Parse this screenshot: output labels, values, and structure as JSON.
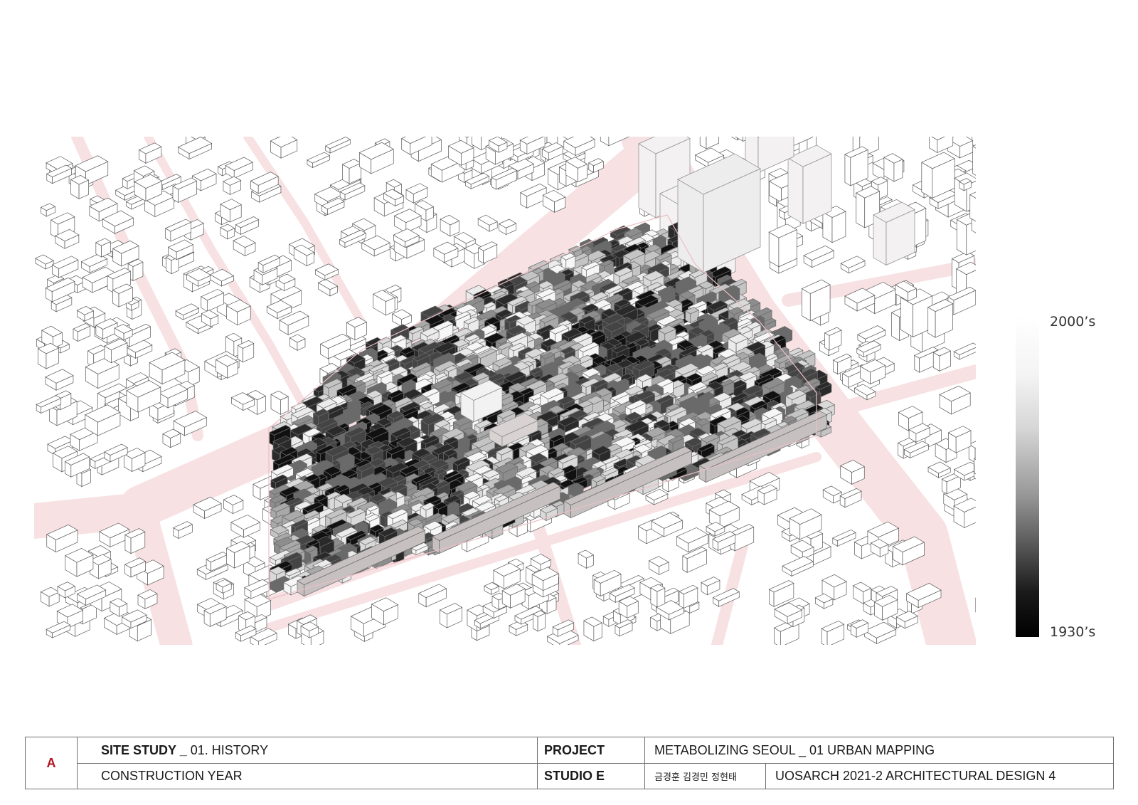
{
  "legend": {
    "top_label": "2000’s",
    "bottom_label": "1930’s",
    "gradient": "white-to-black"
  },
  "colors": {
    "road": "#f7e1e3",
    "road_edge": "#e9bfc4",
    "building_fill": "#ffffff",
    "building_line": "#5a5a5a",
    "logo": "#b3121f"
  },
  "title_block": {
    "logo": "A",
    "section_title": "SITE STUDY _ 01. HISTORY",
    "section_title_bold": "SITE STUDY _",
    "section_title_rest": " 01. HISTORY",
    "subtitle": "CONSTRUCTION YEAR",
    "project_label": "PROJECT",
    "project_value": "METABOLIZING SEOUL _ 01 URBAN MAPPING",
    "studio_label": "STUDIO E",
    "team": "금경훈 김경민 정현태",
    "course": "UOSARCH 2021-2 ARCHITECTURAL DESIGN 4"
  }
}
